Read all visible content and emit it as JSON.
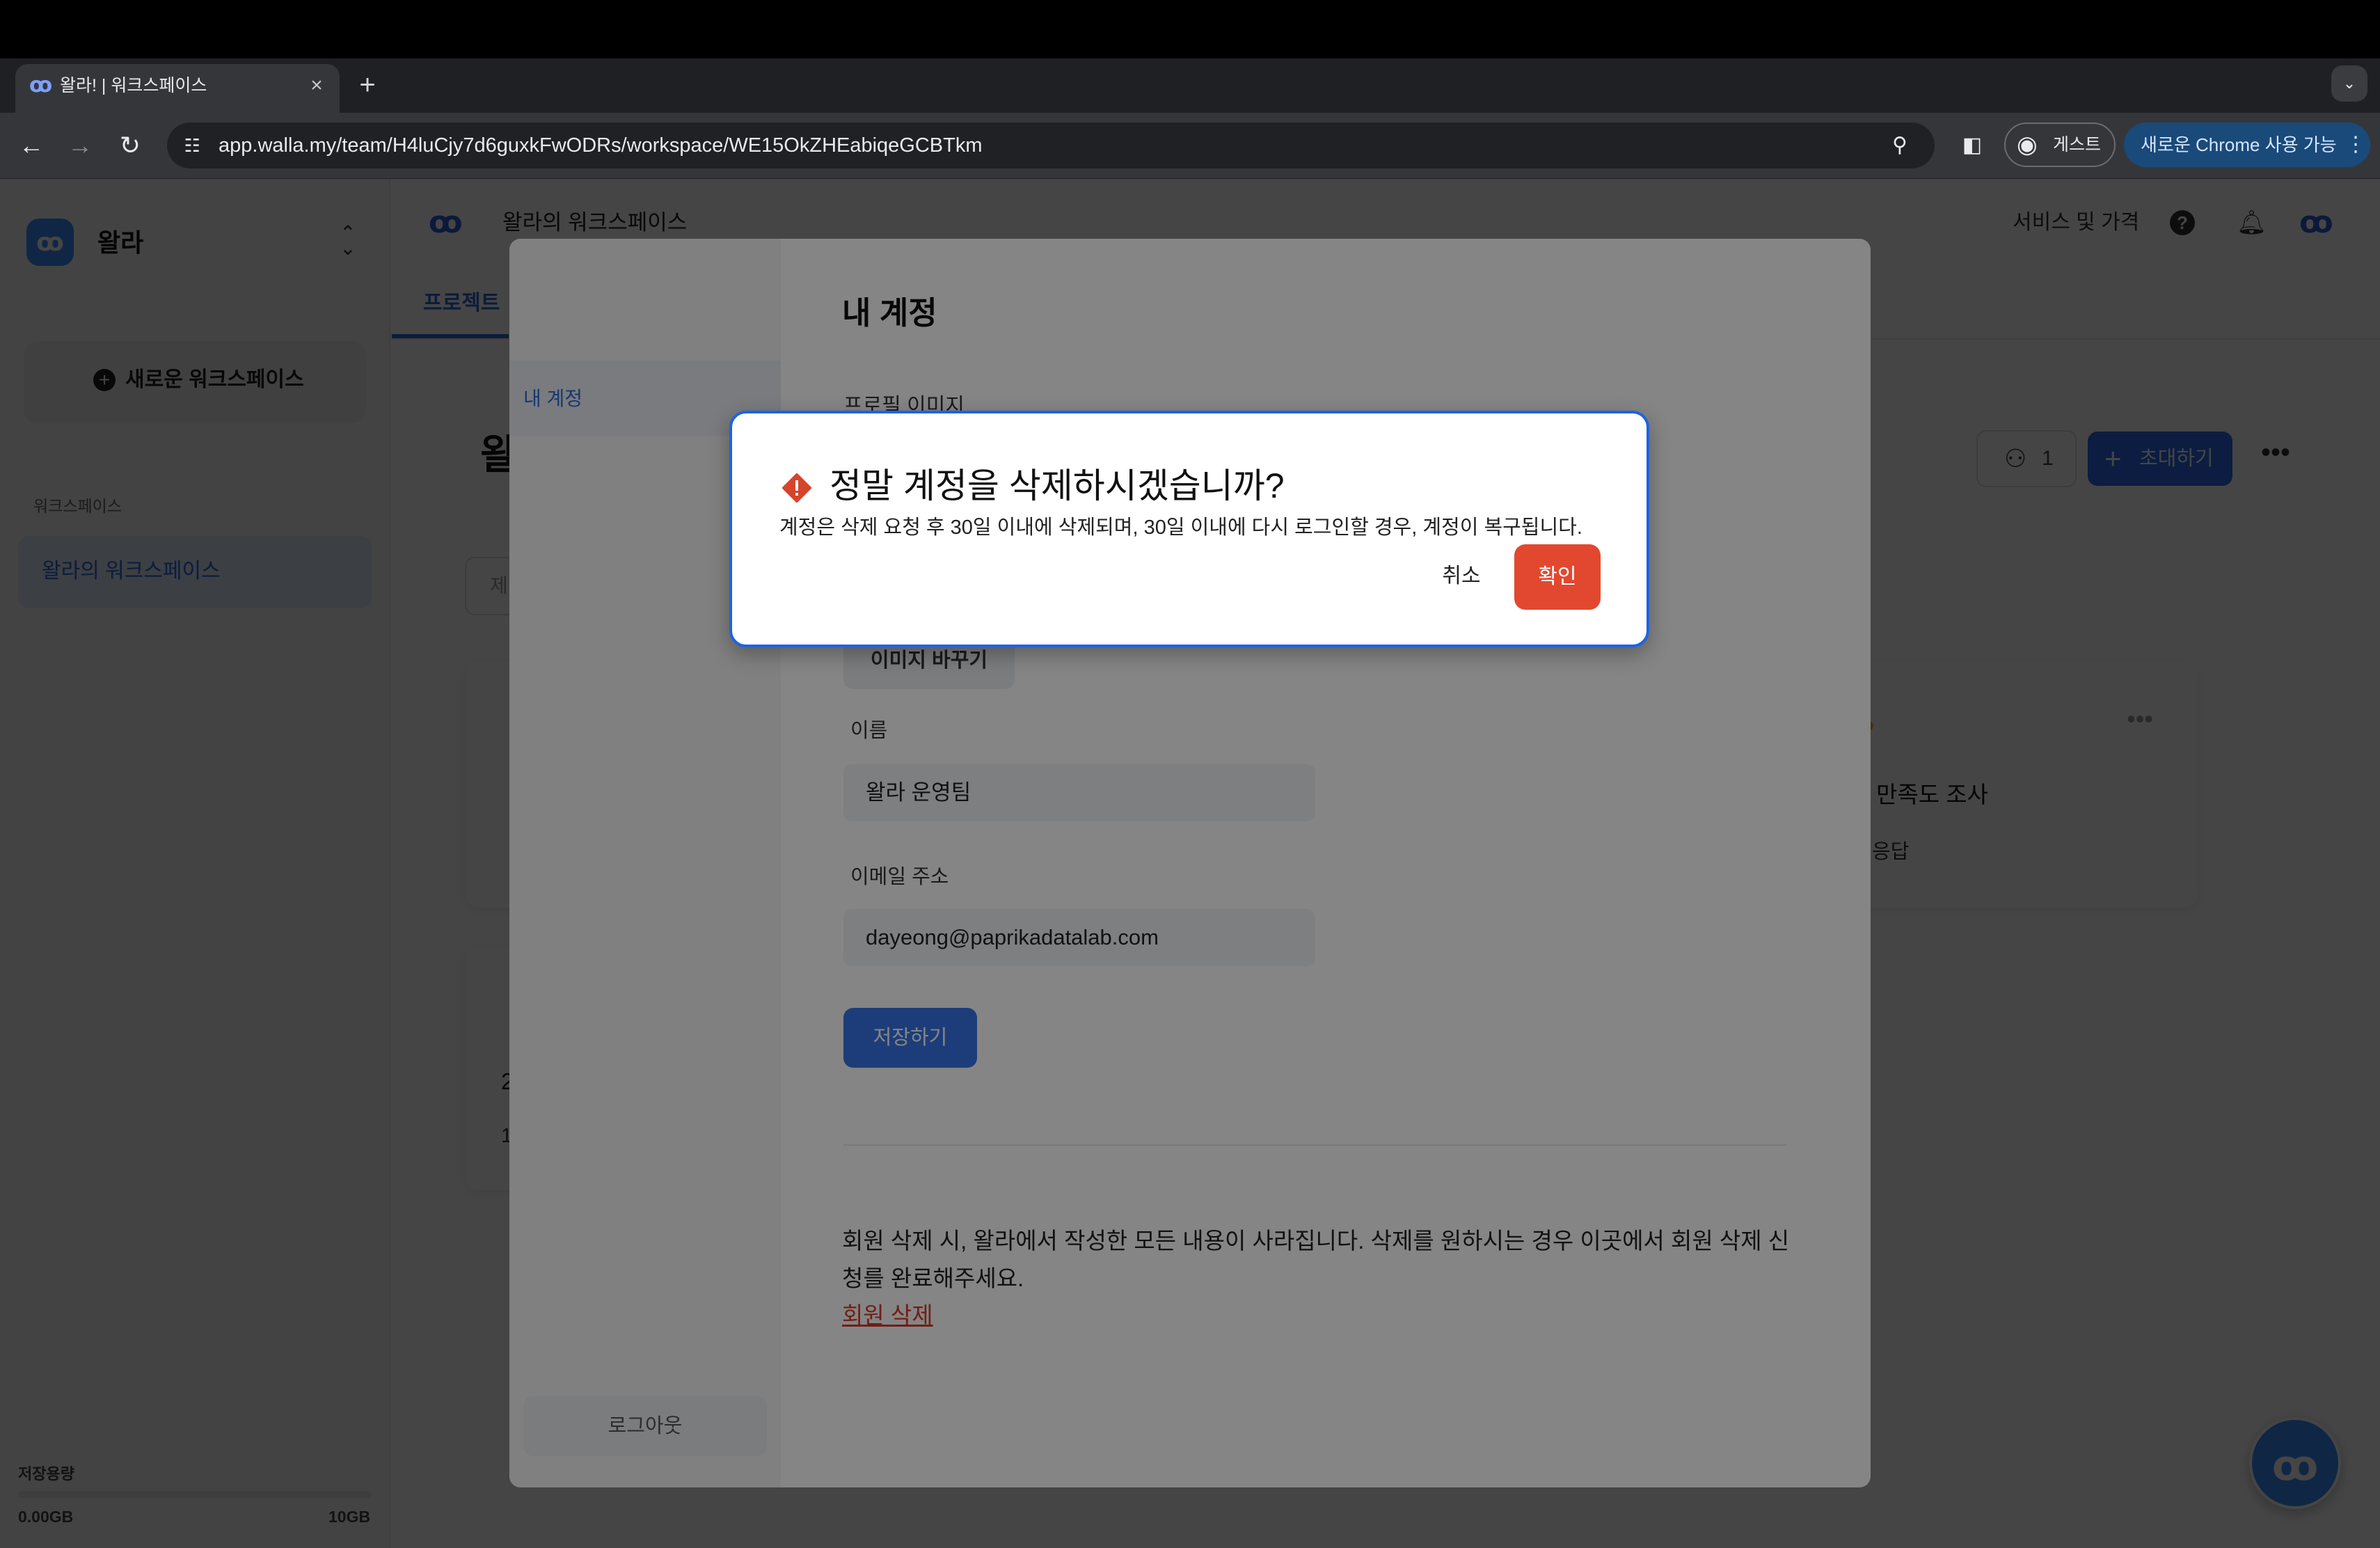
{
  "browser": {
    "tab_title": "왈라! | 워크스페이스",
    "tab_close": "×",
    "new_tab": "+",
    "url": "app.walla.my/team/H4luCjy7d6guxkFwODRs/workspace/WE15OkZHEabiqeGCBTkm",
    "guest_label": "게스트",
    "chrome_promo": "새로운 Chrome 사용 가능"
  },
  "sidebar": {
    "brand_name": "왈라",
    "new_workspace": "새로운 워크스페이스",
    "section_label": "워크스페이스",
    "active_workspace": "왈라의 워크스페이스",
    "storage_label": "저장용량",
    "storage_used": "0.00GB",
    "storage_total": "10GB",
    "storage_fraction": 0.0
  },
  "header": {
    "title": "왈라의 워크스페이스",
    "service_link": "서비스 및 가격",
    "help_icon": "?"
  },
  "main": {
    "tab_project": "프로젝트",
    "heading_partial": "왈",
    "member_count": "1",
    "invite_label": "초대하기",
    "search_partial": "제",
    "card_right_title": "만족도 조사",
    "card_right_meta": "응답",
    "card_left_title": "2",
    "card_left_meta": "1"
  },
  "account_modal": {
    "nav_item": "내 계정",
    "logout": "로그아웃",
    "title": "내 계정",
    "profile_image_label": "프로필 이미지",
    "change_image": "이미지 바꾸기",
    "name_label": "이름",
    "name_value": "왈라 운영팀",
    "email_label": "이메일 주소",
    "email_value": "dayeong@paprikadatalab.com",
    "save": "저장하기",
    "delete_description": "회원 삭제 시, 왈라에서 작성한 모든 내용이 사라집니다. 삭제를 원하시는 경우 이곳에서 회원 삭제 신청를 완료해주세요.",
    "delete_link": "회원 삭제"
  },
  "confirm_dialog": {
    "title": "정말 계정을 삭제하시겠습니까?",
    "description": "계정은 삭제 요청 후 30일 이내에 삭제되며, 30일 이내에 다시 로그인할 경우, 계정이 복구됩니다.",
    "cancel": "취소",
    "confirm": "확인"
  },
  "colors": {
    "accent": "#2f6df2",
    "danger": "#e2482f",
    "dialog_border": "#1f63e0"
  }
}
